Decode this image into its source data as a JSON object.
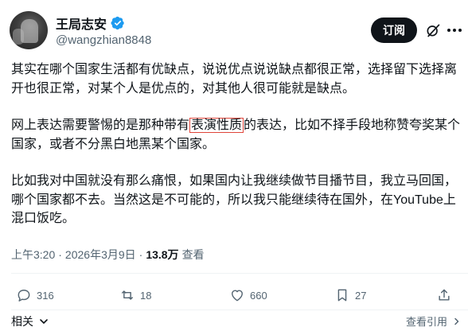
{
  "author": {
    "display_name": "王局志安",
    "handle": "@wangzhian8848"
  },
  "header": {
    "subscribe_label": "订阅"
  },
  "tweet": {
    "para1": "其实在哪个国家生活都有优缺点，说说优点说说缺点都很正常，选择留下选择离开也很正常，对某个人是优点的，对其他人很可能就是缺点。",
    "para2_before": "网上表达需要警惕的是那种带有",
    "para2_highlight": "表演性质",
    "para2_after": "的表达，比如不择手段地称赞夸奖某个国家，或者不分黑白地黑某个国家。",
    "para3": "比如我对中国就没有那么痛恨，如果国内让我继续做节目播节目，我立马回国，哪个国家都不去。当然这是不可能的，所以我只能继续待在国外，在YouTube上混口饭吃。"
  },
  "meta": {
    "time": "上午3:20",
    "sep": "·",
    "date": "2026年3月9日",
    "views_count": "13.8万",
    "views_label": "查看"
  },
  "actions": {
    "replies": "316",
    "reposts": "18",
    "likes": "660",
    "bookmarks": "27"
  },
  "footer": {
    "related_label": "相关",
    "quotes_label": "查看引用"
  },
  "colors": {
    "accent": "#1d9bf0",
    "text": "#0f1419",
    "secondary": "#536471",
    "highlight_border": "#e0453a"
  },
  "icons": [
    "verified-badge-icon",
    "grok-icon",
    "more-icon",
    "reply-icon",
    "repost-icon",
    "like-icon",
    "bookmark-icon",
    "share-icon",
    "chevron-down-icon",
    "chevron-right-icon"
  ]
}
